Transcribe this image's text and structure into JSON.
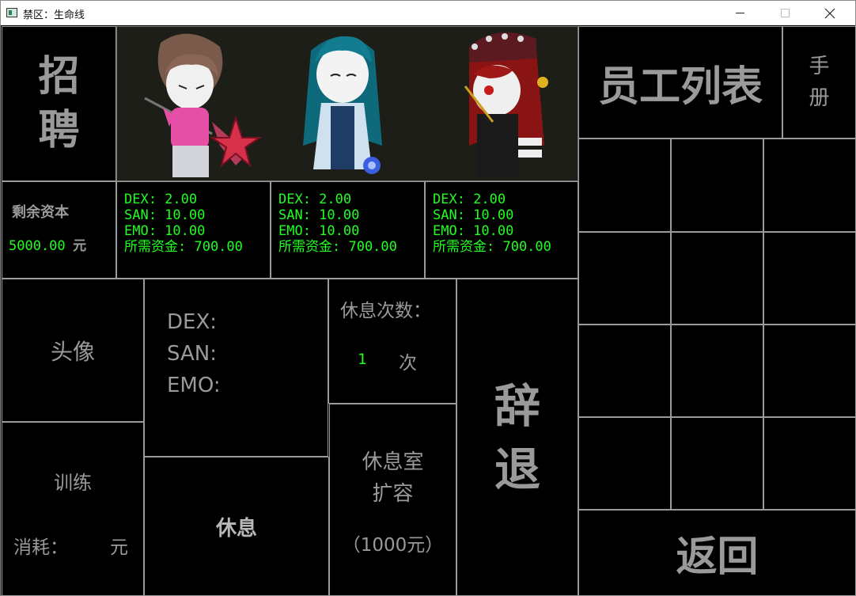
{
  "window": {
    "title": "禁区：生命线"
  },
  "recruit": {
    "title_chars": [
      "招",
      "聘"
    ],
    "funds_label": "剩余资本",
    "funds_value": "5000.00",
    "funds_unit": "元",
    "candidates": [
      {
        "dex": "DEX: 2.00",
        "san": "SAN: 10.00",
        "emo": "EMO: 10.00",
        "cost": "所需资金: 700.00"
      },
      {
        "dex": "DEX: 2.00",
        "san": "SAN: 10.00",
        "emo": "EMO: 10.00",
        "cost": "所需资金: 700.00"
      },
      {
        "dex": "DEX: 2.00",
        "san": "SAN: 10.00",
        "emo": "EMO: 10.00",
        "cost": "所需资金: 700.00"
      }
    ]
  },
  "employee": {
    "avatar_label": "头像",
    "dex_label": "DEX:",
    "san_label": "SAN:",
    "emo_label": "EMO:",
    "train_label": "训练",
    "cost_label": "消耗：",
    "cost_unit": "元",
    "rest_count_label": "休息次数：",
    "rest_count_value": "1",
    "rest_count_unit": "次",
    "rest_button": "休息",
    "expand_line1": "休息室",
    "expand_line2": "扩容",
    "expand_price": "（1000元）",
    "dismiss_chars": [
      "辞",
      "退"
    ]
  },
  "staff_list": {
    "title": "员工列表",
    "manual_chars": [
      "手",
      "册"
    ],
    "back_button": "返回"
  },
  "colors": {
    "background": "#000000",
    "text_gray": "#9a9a9a",
    "stat_green": "#1fff1f",
    "border": "#9b9b9b"
  }
}
